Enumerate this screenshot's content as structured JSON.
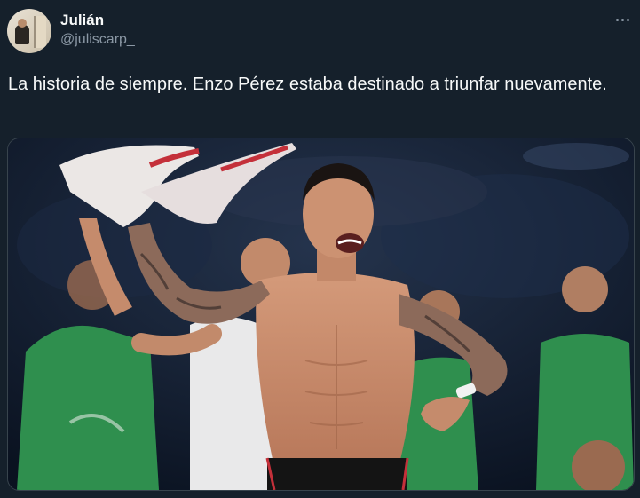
{
  "author": {
    "display_name": "Julián",
    "handle": "@juliscarp_"
  },
  "more_icon": "more-horizontal-icon",
  "tweet": {
    "text": "La historia de siempre. Enzo Pérez estaba destinado a triunfar nuevamente."
  },
  "colors": {
    "background": "#15202b",
    "text": "#f7f9f9",
    "secondary_text": "#8b98a5",
    "jersey_green": "#2f8f4e"
  }
}
